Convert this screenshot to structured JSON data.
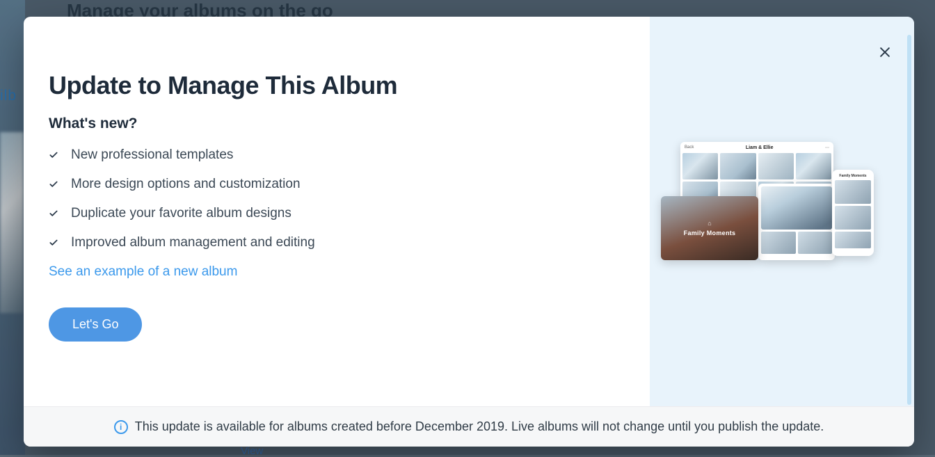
{
  "background": {
    "header": "Manage your albums on the go",
    "tab_fragment": "ilb",
    "view_link": "View"
  },
  "modal": {
    "title": "Update to Manage This Album",
    "subtitle": "What's new?",
    "features": [
      "New professional templates",
      "More design options and customization",
      "Duplicate your favorite album designs",
      "Improved album management and editing"
    ],
    "example_link": "See an example of a new album",
    "cta_label": "Let's Go",
    "footer_notice": "This update is available for albums created before December 2019. Live albums will not change until you publish the update.",
    "preview": {
      "desktop_back": "Back",
      "desktop_title": "Liam & Ellie",
      "cover_title": "Family Moments",
      "phone_title": "Family Moments"
    },
    "icons": {
      "info_glyph": "i"
    }
  }
}
